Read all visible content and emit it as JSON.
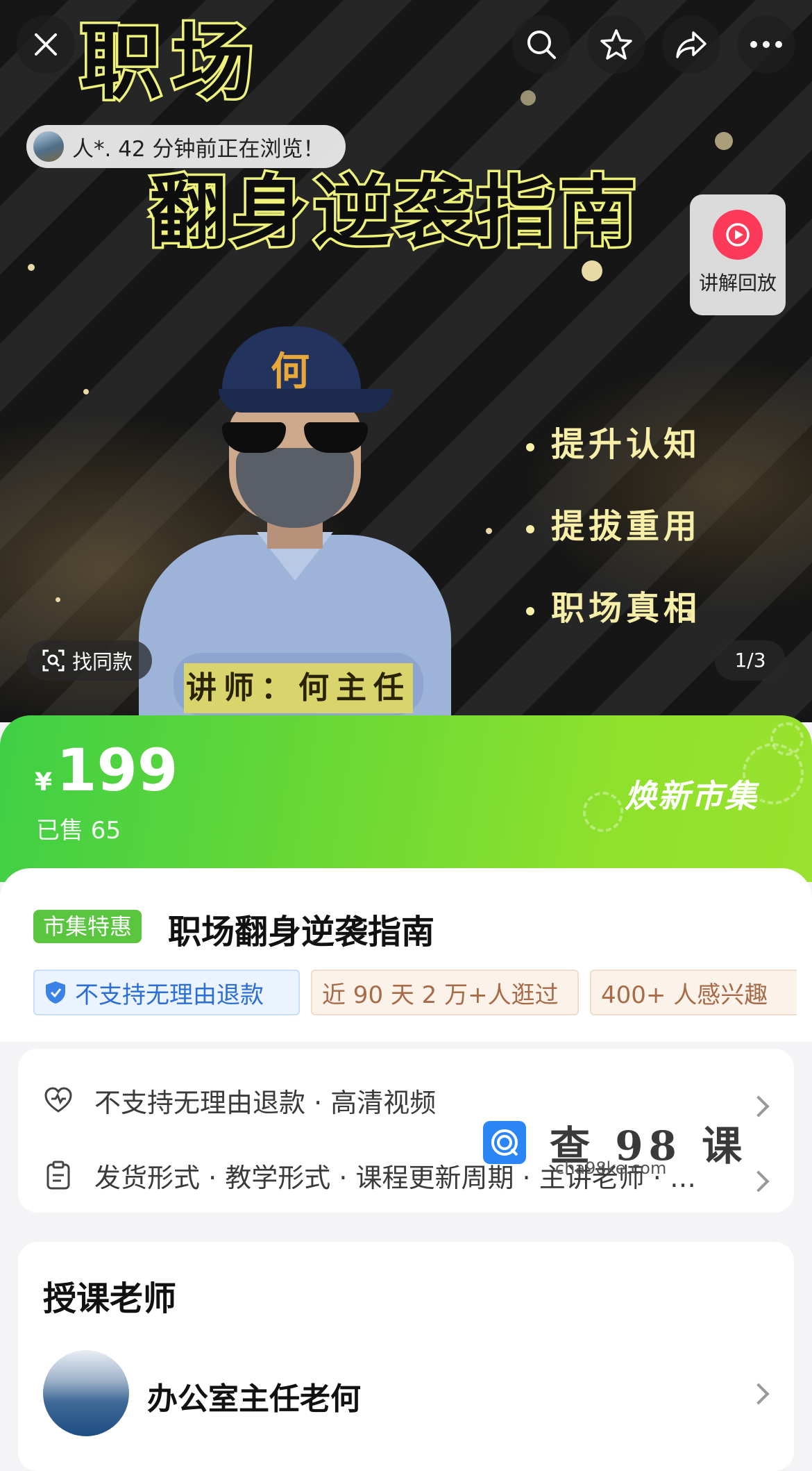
{
  "hero": {
    "title_line1": "职场",
    "title_line2": "翻身逆袭指南",
    "bullets": [
      "提升认知",
      "提拔重用",
      "职场真相"
    ],
    "cap_logo": "何",
    "lecturer": "讲师：何主任",
    "viewing_text": "人*. 42 分钟前正在浏览！",
    "replay_label": "讲解回放",
    "find_same": "找同款",
    "page_indicator": "1/3"
  },
  "top_icons": [
    "close-icon",
    "search-icon",
    "star-icon",
    "share-icon",
    "more-icon"
  ],
  "price": {
    "currency": "¥",
    "value": "199",
    "sold": "已售 65",
    "brand": "焕新市集"
  },
  "product": {
    "tag": "市集特惠",
    "title": "职场翻身逆袭指南",
    "chips": [
      "不支持无理由退款",
      "近 90 天 2 万+人逛过",
      "400+ 人感兴趣"
    ]
  },
  "info": {
    "row1": "不支持无理由退款 · 高清视频",
    "row2": "发货形式 · 教学形式 · 课程更新周期 · 主讲老师 · …"
  },
  "watermark": {
    "text": "查 98 课",
    "url": "cha98ke.com"
  },
  "teacher": {
    "heading": "授课老师",
    "name": "办公室主任老何"
  },
  "colors": {
    "accent_green": "#5ac63f",
    "replay_red": "#fe3a5b",
    "chip_blue": "#2b6ed6",
    "chip_tan": "#a86a47"
  }
}
